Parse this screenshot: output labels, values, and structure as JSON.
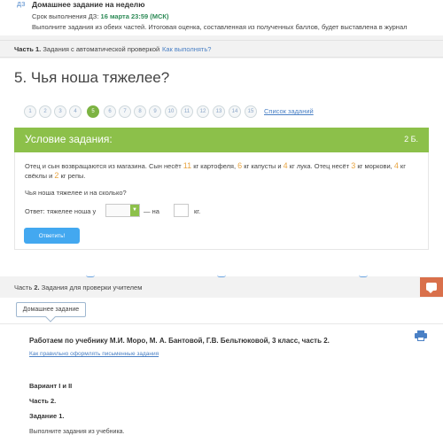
{
  "homework": {
    "icon": "ДЗ",
    "title": "Домашнее задание на неделю",
    "deadline_label": "Срок выполнения ДЗ:",
    "deadline_value": "16 марта 23:59 (МСК)",
    "note": "Выполните задания из обеих частей. Итоговая оценка, составленная из полученных баллов, будет выставлена в журнал"
  },
  "part1": {
    "label_bold": "Часть 1.",
    "label": "Задания с автоматической проверкой",
    "how_link": "Как выполнять?"
  },
  "task": {
    "title": "5. Чья ноша тяжелее?",
    "pages": [
      "1",
      "2",
      "3",
      "4",
      "5",
      "6",
      "7",
      "8",
      "9",
      "10",
      "11",
      "12",
      "13",
      "14",
      "15"
    ],
    "active_page": "5",
    "list_link": "Список заданий"
  },
  "condition": {
    "header": "Условие задания:",
    "points": "2 Б.",
    "t1": "Отец и сын возвращаются из магазина. Сын несёт ",
    "n1": "11",
    "t2": " кг картофеля, ",
    "n2": "6",
    "t3": " кг капусты и ",
    "n3": "4",
    "t4": " кг лука. Отец несёт ",
    "n4": "3",
    "t5": " кг моркови, ",
    "n5": "4",
    "t6": " кг свёклы и ",
    "n6": "2",
    "t7": " кг репы.",
    "question": "Чья ноша тяжелее и на сколько?",
    "answer_label": "Ответ: тяжелее ноша у",
    "dash_label": "— на",
    "unit": "кг.",
    "submit_label": "Ответить!"
  },
  "part2": {
    "label_pre": "Часть ",
    "label_bold": "2.",
    "label": "Задания для проверки учителем"
  },
  "teacher": {
    "tab": "Домашнее задание",
    "book": "Работаем по учебнику М.И. Моро, М. А. Бантовой, Г.В. Бельтюковой, 3 класс, часть 2.",
    "link": "Как правильно оформлять письменные задания",
    "variant": "Вариант I и II",
    "part": "Часть 2.",
    "task": "Задание 1.",
    "do": "Выполните задания из учебника."
  },
  "colors": {
    "accent_green": "#8cc04a",
    "link_blue": "#4a80c5",
    "button_blue": "#43a8f0",
    "number_orange": "#e8a440",
    "chat_orange": "#d9704b"
  }
}
